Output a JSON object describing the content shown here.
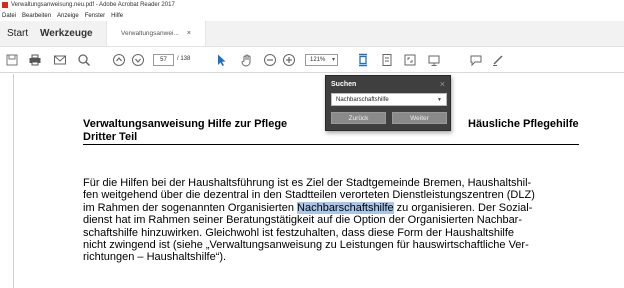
{
  "window": {
    "title": "Verwaltungsanweisung.neu.pdf - Adobe Acrobat Reader 2017"
  },
  "menu": [
    "Datei",
    "Bearbeiten",
    "Anzeige",
    "Fenster",
    "Hilfe"
  ],
  "tabs": {
    "home": "Start",
    "tools": "Werkzeuge",
    "document": "Verwaltungsanwei...",
    "close_symbol": "×"
  },
  "toolbar": {
    "page_current": "57",
    "page_total": "/ 138",
    "zoom": "121%",
    "icons": [
      "save-icon",
      "print-icon",
      "email-icon",
      "search-icon",
      "page-up-icon",
      "page-down-icon",
      "select-cursor-icon",
      "hand-tool-icon",
      "zoom-out-icon",
      "zoom-in-icon",
      "fit-page-icon",
      "scroll-mode-icon",
      "full-screen-icon",
      "read-mode-icon",
      "comment-icon",
      "sign-icon"
    ]
  },
  "search_popup": {
    "title": "Suchen",
    "close_symbol": "×",
    "query": "Nachbarschaftshilfe",
    "prev_label": "Zurück",
    "next_label": "Weiter"
  },
  "document": {
    "heading_line1": "Verwaltungsanweisung Hilfe zur Pflege",
    "heading_line2": "Dritter Teil",
    "heading_right": "Häusliche Pflegehilfe",
    "paragraph_lines": {
      "l1": "Für die Hilfen bei der Haushaltsführung ist es Ziel der Stadtgemeinde Bremen, Haushaltshil-",
      "l2": "fen weitgehend über die dezentral in den Stadtteilen verorteten Dienstleistungszentren (DLZ)",
      "l3_before": "im Rahmen der sogenannten Organisierten ",
      "l3_highlight": "Nachbarschaftshilfe",
      "l3_after": " zu organisieren. Der Sozial-",
      "l4": "dienst hat im Rahmen seiner Beratungstätigkeit auf die Option der Organisierten Nachbar-",
      "l5": "schaftshilfe hinzuwirken. Gleichwohl ist festzuhalten, dass diese Form der Haushaltshilfe",
      "l6": "nicht zwingend ist (siehe „Verwaltungsanweisung zu Leistungen für hauswirtschaftliche Ver-",
      "l7": "richtungen – Haushaltshilfe“)."
    }
  },
  "colors": {
    "highlight": "#a9c6e8",
    "acrobat_red": "#d52b1e",
    "toolbar_blue": "#1f6fc5"
  }
}
